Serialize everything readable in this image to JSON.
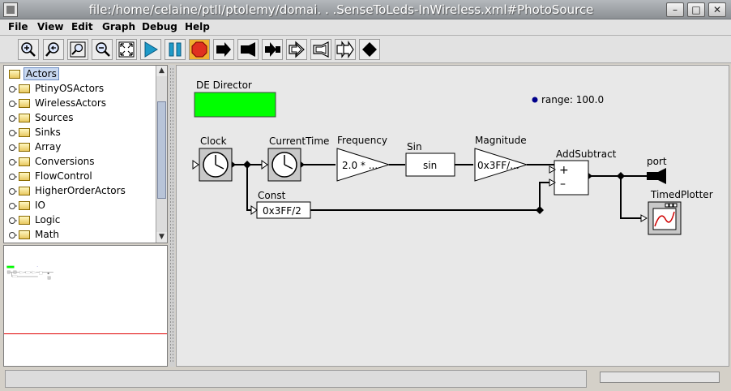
{
  "window": {
    "title": "file:/home/celaine/ptII/ptolemy/domai. . .SenseToLeds-InWireless.xml#PhotoSource",
    "minimize_label": "–",
    "maximize_label": "□",
    "close_label": "✕"
  },
  "menu": {
    "items": [
      {
        "label": "File"
      },
      {
        "label": "View"
      },
      {
        "label": "Edit"
      },
      {
        "label": "Graph"
      },
      {
        "label": "Debug"
      },
      {
        "label": "Help"
      }
    ]
  },
  "toolbar": {
    "buttons": [
      {
        "icon": "zoom-in-icon"
      },
      {
        "icon": "zoom-reset-icon"
      },
      {
        "icon": "zoom-fit-icon"
      },
      {
        "icon": "zoom-out-icon"
      },
      {
        "icon": "full-screen-icon"
      },
      {
        "icon": "run-icon"
      },
      {
        "icon": "pause-icon"
      },
      {
        "icon": "stop-icon"
      },
      {
        "icon": "input-port-icon"
      },
      {
        "icon": "output-port-icon"
      },
      {
        "icon": "io-port-icon"
      },
      {
        "icon": "multiport-input-icon"
      },
      {
        "icon": "multiport-output-icon"
      },
      {
        "icon": "multiport-io-icon"
      },
      {
        "icon": "relation-icon"
      }
    ],
    "colors": {
      "run": "#1e9ac8",
      "stop": "#e03020",
      "stop_bg": "#f0b030"
    }
  },
  "library": {
    "root": "Actors",
    "items": [
      {
        "label": "PtinyOSActors"
      },
      {
        "label": "WirelessActors"
      },
      {
        "label": "Sources"
      },
      {
        "label": "Sinks"
      },
      {
        "label": "Array"
      },
      {
        "label": "Conversions"
      },
      {
        "label": "FlowControl"
      },
      {
        "label": "HigherOrderActors"
      },
      {
        "label": "IO"
      },
      {
        "label": "Logic"
      },
      {
        "label": "Math"
      }
    ]
  },
  "model": {
    "director": {
      "label": "DE Director",
      "color": "#00ff00"
    },
    "parameter": {
      "text": "range: 100.0"
    },
    "actors": {
      "clock": {
        "label": "Clock"
      },
      "current_time": {
        "label": "CurrentTime"
      },
      "frequency": {
        "label": "Frequency",
        "text": "2.0 * ..."
      },
      "sin": {
        "label": "Sin",
        "text": "sin"
      },
      "magnitude": {
        "label": "Magnitude",
        "text": "0x3FF/..."
      },
      "add_subtract": {
        "label": "AddSubtract",
        "plus": "+",
        "minus": "–"
      },
      "const": {
        "label": "Const",
        "text": "0x3FF/2"
      },
      "port": {
        "label": "port"
      },
      "timed_plotter": {
        "label": "TimedPlotter"
      }
    }
  },
  "status": {
    "text": "",
    "progress": 0
  }
}
